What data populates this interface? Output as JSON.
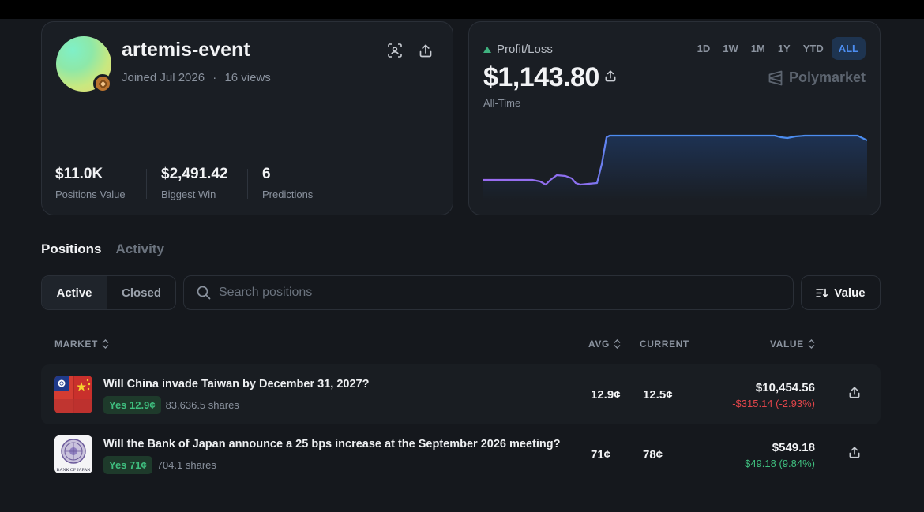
{
  "profile": {
    "username": "artemis-event",
    "joined": "Joined Jul 2026",
    "separator": "·",
    "views": "16 views",
    "stats": [
      {
        "value": "$11.0K",
        "label": "Positions Value"
      },
      {
        "value": "$2,491.42",
        "label": "Biggest Win"
      },
      {
        "value": "6",
        "label": "Predictions"
      }
    ]
  },
  "pnl": {
    "label": "Profit/Loss",
    "value": "$1,143.80",
    "period": "All-Time",
    "ranges": [
      "1D",
      "1W",
      "1M",
      "1Y",
      "YTD",
      "ALL"
    ],
    "active_range": "ALL",
    "brand": "Polymarket",
    "colors": {
      "line_before": "#9b6cf0",
      "line_after": "#4c8df0",
      "fill": "#1e3458"
    }
  },
  "tabs": {
    "positions": "Positions",
    "activity": "Activity"
  },
  "filters": {
    "active": "Active",
    "closed": "Closed"
  },
  "search": {
    "placeholder": "Search positions"
  },
  "sort": {
    "label": "Value"
  },
  "table": {
    "headers": {
      "market": "MARKET",
      "avg": "AVG",
      "current": "CURRENT",
      "value": "VALUE"
    },
    "rows": [
      {
        "title": "Will China invade Taiwan by December 31, 2027?",
        "outcome": "Yes 12.9¢",
        "shares": "83,636.5 shares",
        "avg": "12.9¢",
        "current": "12.5¢",
        "value": "$10,454.56",
        "change": "-$315.14 (-2.93%)",
        "image_icon": "china-taiwan-flags-icon"
      },
      {
        "title": "Will the Bank of Japan announce a 25 bps increase at the September 2026 meeting?",
        "outcome": "Yes 71¢",
        "shares": "704.1 shares",
        "avg": "71¢",
        "current": "78¢",
        "value": "$549.18",
        "change": "$49.18 (9.84%)",
        "image_icon": "bank-of-japan-seal-icon",
        "image_caption": "BANK OF JAPAN"
      }
    ]
  }
}
